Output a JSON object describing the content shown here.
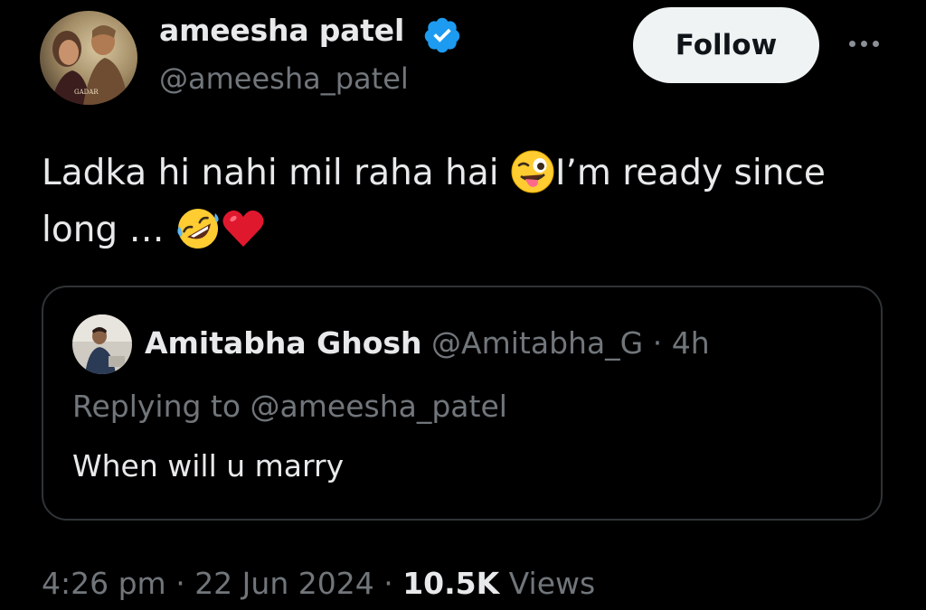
{
  "author": {
    "display_name": "ameesha patel",
    "handle": "@ameesha_patel",
    "verified": true,
    "avatar_caption": "GADAR"
  },
  "actions": {
    "follow_label": "Follow",
    "more_icon": "more-horizontal-icon"
  },
  "tweet": {
    "text_part1": "Ladka hi nahi mil raha hai ",
    "emoji_1": "winking-face-with-tongue",
    "text_part2": "I’m ready since long … ",
    "emoji_2": "rolling-on-the-floor-laughing",
    "emoji_3": "red-heart"
  },
  "quoted": {
    "display_name": "Amitabha Ghosh",
    "handle": "@Amitabha_G",
    "separator": " · ",
    "time_ago": "4h",
    "replying_prefix": "Replying to ",
    "replying_to": "@ameesha_patel",
    "text": "When will u marry"
  },
  "footer": {
    "time": "4:26 pm",
    "sep1": " · ",
    "date": "22 Jun 2024",
    "sep2": " · ",
    "views_count": "10.5K",
    "views_label": " Views"
  },
  "colors": {
    "background": "#000000",
    "primary_text": "#e7e9ea",
    "secondary_text": "#71767b",
    "verified_blue": "#1d9bf0",
    "follow_bg": "#eff3f4",
    "border": "#2f3336"
  }
}
